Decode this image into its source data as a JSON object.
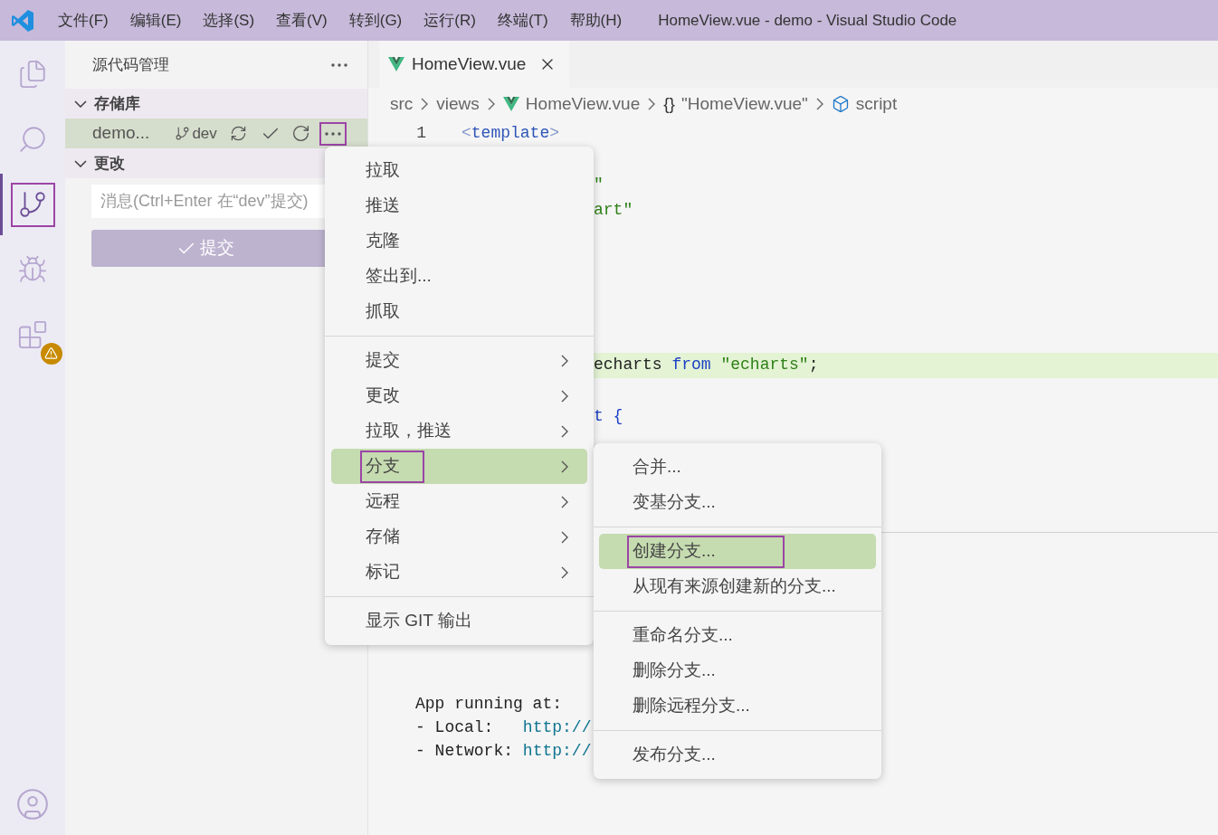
{
  "title_bar": {
    "menus": [
      "文件(F)",
      "编辑(E)",
      "选择(S)",
      "查看(V)",
      "转到(G)",
      "运行(R)",
      "终端(T)",
      "帮助(H)"
    ],
    "title": "HomeView.vue - demo - Visual Studio Code"
  },
  "activity_bar": {
    "items": [
      {
        "kind": "explorer",
        "selected": false,
        "outlined": false
      },
      {
        "kind": "search",
        "selected": false,
        "outlined": false
      },
      {
        "kind": "source_control",
        "selected": true,
        "outlined": true
      },
      {
        "kind": "run_debug",
        "selected": false,
        "outlined": false
      },
      {
        "kind": "extensions",
        "selected": false,
        "outlined": false,
        "warning": true
      }
    ],
    "account": {
      "kind": "account"
    }
  },
  "sidebar": {
    "title": "源代码管理",
    "repositories": {
      "label": "存储库",
      "expanded": true,
      "repo": {
        "name": "demo...",
        "branch": "dev",
        "selected": true,
        "more_outlined": true
      }
    },
    "changes": {
      "label": "更改",
      "expanded": true,
      "message": {
        "placeholder": "消息(Ctrl+Enter 在“dev”提交)"
      },
      "commit_button": {
        "label": "提交",
        "disabled": true
      }
    }
  },
  "editor": {
    "tab": {
      "label": "HomeView.vue",
      "selected": true
    },
    "breadcrumb": [
      {
        "kind": "folder",
        "text": "src"
      },
      {
        "kind": "folder",
        "text": "views"
      },
      {
        "kind": "vue",
        "text": "HomeView.vue"
      },
      {
        "kind": "object",
        "icon": "{}",
        "text": "\"HomeView.vue\""
      },
      {
        "kind": "module",
        "text": "script"
      }
    ],
    "lines": [
      {
        "kind": "full",
        "number": "1",
        "highlighted": false,
        "tokens": [
          {
            "kind": "bracket",
            "text": "<"
          },
          {
            "kind": "tag",
            "text": "template"
          },
          {
            "kind": "bracket",
            "text": ">"
          }
        ]
      },
      {
        "kind": "hidden"
      },
      {
        "kind": "partial",
        "highlighted": false,
        "tokens": [
          {
            "kind": "string",
            "text": "\""
          }
        ]
      },
      {
        "kind": "partial",
        "highlighted": false,
        "tokens": [
          {
            "kind": "string",
            "text": "art\""
          }
        ]
      },
      {
        "kind": "hidden"
      },
      {
        "kind": "hidden"
      },
      {
        "kind": "hidden"
      },
      {
        "kind": "hidden"
      },
      {
        "kind": "hidden"
      },
      {
        "kind": "partial",
        "highlighted": true,
        "tokens": [
          {
            "kind": "plain",
            "text": "echarts "
          },
          {
            "kind": "keyword",
            "text": "from"
          },
          {
            "kind": "string",
            "text": " \"echarts\""
          },
          {
            "kind": "plain",
            "text": ";"
          }
        ]
      },
      {
        "kind": "hidden"
      },
      {
        "kind": "partial",
        "highlighted": false,
        "tokens": [
          {
            "kind": "keyword",
            "text": "t"
          },
          {
            "kind": "brace",
            "text": " {"
          }
        ]
      }
    ],
    "terminal": [
      [
        {
          "kind": "plain",
          "text": "App running at:"
        }
      ],
      [
        {
          "kind": "plain",
          "text": "- Local:   "
        },
        {
          "kind": "link",
          "text": "http://"
        }
      ],
      [
        {
          "kind": "plain",
          "text": "- Network: "
        },
        {
          "kind": "link",
          "text": "http://"
        }
      ]
    ]
  },
  "context_menu": {
    "groups": [
      [
        {
          "label": "拉取",
          "submenu": false,
          "selected": false,
          "outlined": false
        },
        {
          "label": "推送",
          "submenu": false,
          "selected": false,
          "outlined": false
        },
        {
          "label": "克隆",
          "submenu": false,
          "selected": false,
          "outlined": false
        },
        {
          "label": "签出到...",
          "submenu": false,
          "selected": false,
          "outlined": false
        },
        {
          "label": "抓取",
          "submenu": false,
          "selected": false,
          "outlined": false
        }
      ],
      [
        {
          "label": "提交",
          "submenu": true,
          "selected": false,
          "outlined": false
        },
        {
          "label": "更改",
          "submenu": true,
          "selected": false,
          "outlined": false
        },
        {
          "label": "拉取，推送",
          "submenu": true,
          "selected": false,
          "outlined": false
        },
        {
          "label": "分支",
          "submenu": true,
          "selected": true,
          "outlined": true
        },
        {
          "label": "远程",
          "submenu": true,
          "selected": false,
          "outlined": false
        },
        {
          "label": "存储",
          "submenu": true,
          "selected": false,
          "outlined": false
        },
        {
          "label": "标记",
          "submenu": true,
          "selected": false,
          "outlined": false
        }
      ],
      [
        {
          "label": "显示 GIT 输出",
          "submenu": false,
          "selected": false,
          "outlined": false
        }
      ]
    ]
  },
  "submenu": {
    "groups": [
      [
        {
          "label": "合并...",
          "selected": false,
          "outlined": false
        },
        {
          "label": "变基分支...",
          "selected": false,
          "outlined": false
        }
      ],
      [
        {
          "label": "创建分支...",
          "selected": true,
          "outlined": true
        },
        {
          "label": "从现有来源创建新的分支...",
          "selected": false,
          "outlined": false
        }
      ],
      [
        {
          "label": "重命名分支...",
          "selected": false,
          "outlined": false
        },
        {
          "label": "删除分支...",
          "selected": false,
          "outlined": false
        },
        {
          "label": "删除远程分支...",
          "selected": false,
          "outlined": false
        }
      ],
      [
        {
          "label": "发布分支...",
          "selected": false,
          "outlined": false
        }
      ]
    ]
  }
}
